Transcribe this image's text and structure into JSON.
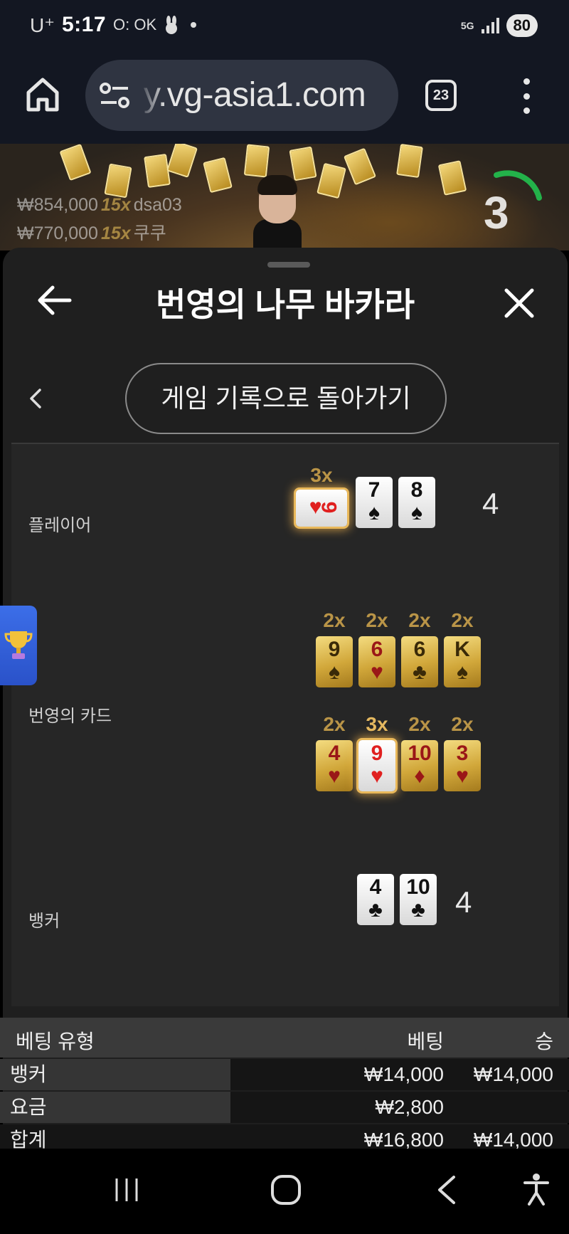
{
  "status_bar": {
    "carrier": "U⁺",
    "time": "5:17",
    "icons_text": "O: OK",
    "network": "5G",
    "battery": "80"
  },
  "browser": {
    "url": "y.vg-asia1.com",
    "tab_count": "23"
  },
  "hero": {
    "wins": [
      {
        "amount": "₩854,000",
        "multiplier": "15x",
        "user": "dsa03"
      },
      {
        "amount": "₩770,000",
        "multiplier": "15x",
        "user": "쿠쿠"
      }
    ],
    "countdown": "3"
  },
  "panel": {
    "title": "번영의 나무 바카라",
    "return_label": "게임 기록으로 돌아가기"
  },
  "result": {
    "player": {
      "label": "플레이어",
      "score": "4",
      "multiplier": "3x",
      "cards": [
        {
          "rank": "9",
          "suit": "♥"
        },
        {
          "rank": "7",
          "suit": "♠"
        },
        {
          "rank": "8",
          "suit": "♠"
        }
      ]
    },
    "prosperity": {
      "label": "번영의 카드",
      "row1": [
        {
          "mult": "2x",
          "rank": "9",
          "suit": "♠"
        },
        {
          "mult": "2x",
          "rank": "6",
          "suit": "♥"
        },
        {
          "mult": "2x",
          "rank": "6",
          "suit": "♣"
        },
        {
          "mult": "2x",
          "rank": "K",
          "suit": "♠"
        }
      ],
      "row2": [
        {
          "mult": "2x",
          "rank": "4",
          "suit": "♥"
        },
        {
          "mult": "3x",
          "rank": "9",
          "suit": "♥"
        },
        {
          "mult": "2x",
          "rank": "10",
          "suit": "♦"
        },
        {
          "mult": "2x",
          "rank": "3",
          "suit": "♥"
        }
      ]
    },
    "banker": {
      "label": "뱅커",
      "score": "4",
      "cards": [
        {
          "rank": "4",
          "suit": "♣"
        },
        {
          "rank": "10",
          "suit": "♣"
        }
      ]
    }
  },
  "bet_table": {
    "headers": {
      "type": "베팅 유형",
      "bet": "베팅",
      "win": "승"
    },
    "rows": [
      {
        "type": "뱅커",
        "bet": "₩14,000",
        "win": "₩14,000"
      },
      {
        "type": "요금",
        "bet": "₩2,800",
        "win": ""
      },
      {
        "type": "합계",
        "bet": "₩16,800",
        "win": "₩14,000"
      }
    ]
  },
  "colors": {
    "accent_gold": "#b99447",
    "card_red": "#e0201f",
    "trophy_tab": "#3c6ee8"
  }
}
